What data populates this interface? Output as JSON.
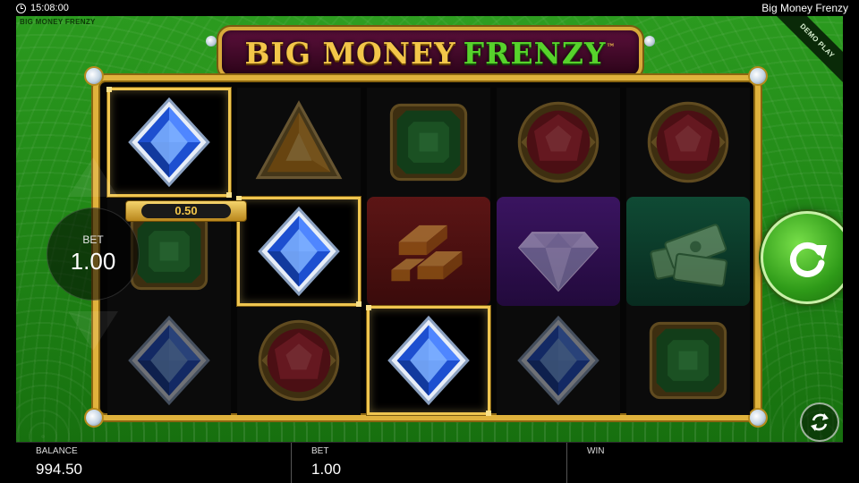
{
  "status_bar": {
    "time": "15:08:00",
    "game_title": "Big Money Frenzy"
  },
  "game": {
    "brand_small": "BIG MONEY FRENZY",
    "demo_label": "DEMO PLAY",
    "logo": {
      "word1": "BIG MONEY",
      "word2": "FRENZY",
      "tm": "™"
    },
    "win_tag_value": "0.50",
    "bet_selector": {
      "label": "BET",
      "value": "1.00"
    },
    "reels": [
      [
        "blue-diamond",
        "green-emerald",
        "blue-diamond"
      ],
      [
        "orange-triangle",
        "blue-diamond",
        "red-ruby"
      ],
      [
        "green-emerald",
        "gold-bars",
        "blue-diamond"
      ],
      [
        "red-ruby",
        "crystal-diamond",
        "blue-diamond"
      ],
      [
        "red-ruby",
        "cash-stack",
        "green-emerald"
      ]
    ],
    "winning_cells": [
      [
        0,
        0
      ],
      [
        1,
        1
      ],
      [
        2,
        2
      ]
    ]
  },
  "bottom_bar": {
    "balance_label": "BALANCE",
    "balance_value": "994.50",
    "bet_label": "BET",
    "bet_value": "1.00",
    "win_label": "WIN",
    "win_value": ""
  },
  "colors": {
    "felt_green": "#1f8415",
    "gold": "#e0b23c",
    "logo_maroon": "#5a0f3a",
    "brand_green": "#57d22c"
  }
}
